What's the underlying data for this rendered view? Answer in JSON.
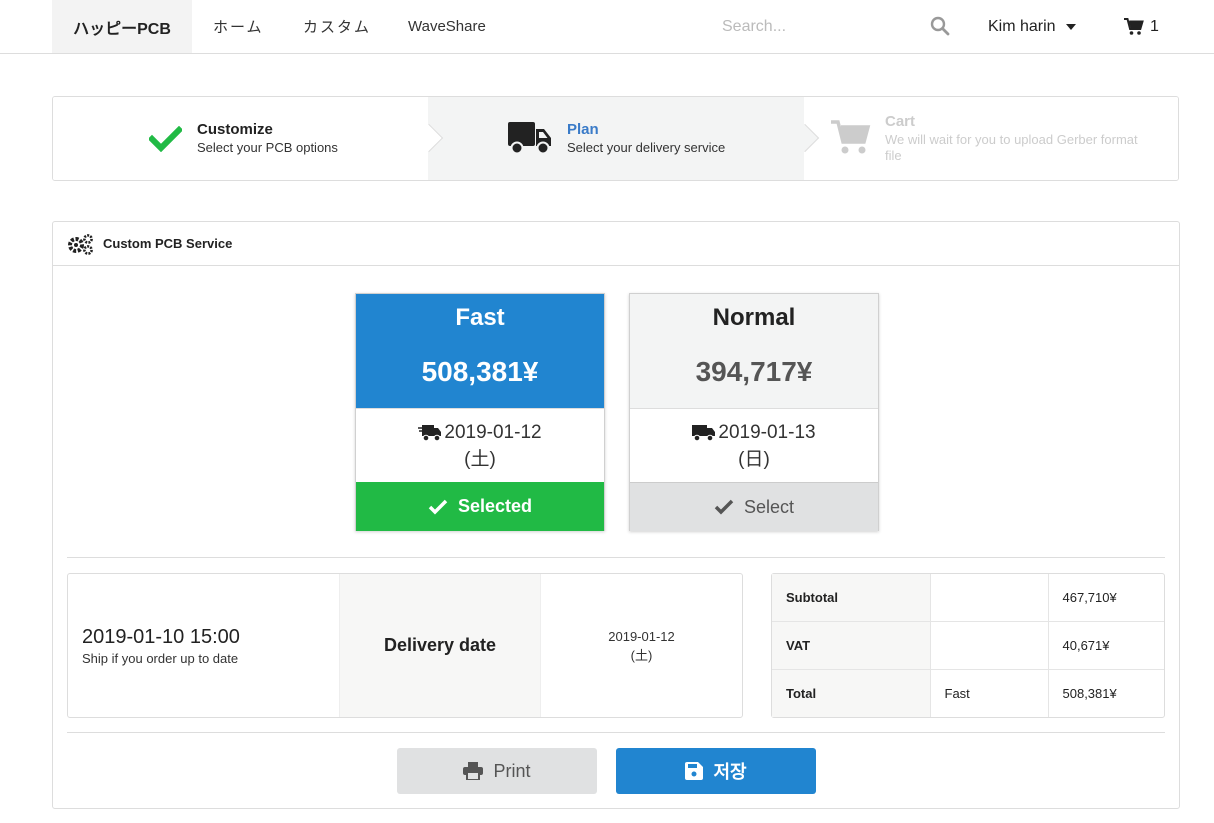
{
  "nav": {
    "brand": "ハッピーPCB",
    "links": [
      "ホーム",
      "カスタム",
      "WaveShare"
    ],
    "search_placeholder": "Search...",
    "user": "Kim harin",
    "cart_count": "1"
  },
  "steps": [
    {
      "title": "Customize",
      "subtitle": "Select your PCB options",
      "state": "completed"
    },
    {
      "title": "Plan",
      "subtitle": "Select your delivery service",
      "state": "active"
    },
    {
      "title": "Cart",
      "subtitle": "We will wait for you to upload Gerber format file",
      "state": "disabled"
    }
  ],
  "panel": {
    "title": "Custom PCB Service",
    "options": [
      {
        "name": "Fast",
        "price": "508,381¥",
        "date": "2019-01-12",
        "day": "(土)",
        "button": "Selected",
        "selected": true
      },
      {
        "name": "Normal",
        "price": "394,717¥",
        "date": "2019-01-13",
        "day": "(日)",
        "button": "Select",
        "selected": false
      }
    ],
    "ship": {
      "deadline": "2019-01-10 15:00",
      "deadline_note": "Ship if you order up to date",
      "delivery_label": "Delivery date",
      "delivery_date": "2019-01-12",
      "delivery_day": "(土)"
    },
    "totals": [
      {
        "label": "Subtotal",
        "mid": "",
        "value": "467,710¥"
      },
      {
        "label": "VAT",
        "mid": "",
        "value": "40,671¥"
      },
      {
        "label": "Total",
        "mid": "Fast",
        "value": "508,381¥"
      }
    ],
    "buttons": {
      "print": "Print",
      "save": "저장"
    }
  },
  "colors": {
    "primary": "#2185d0",
    "success": "#21ba45",
    "step_active_title": "#3a7bc8"
  }
}
